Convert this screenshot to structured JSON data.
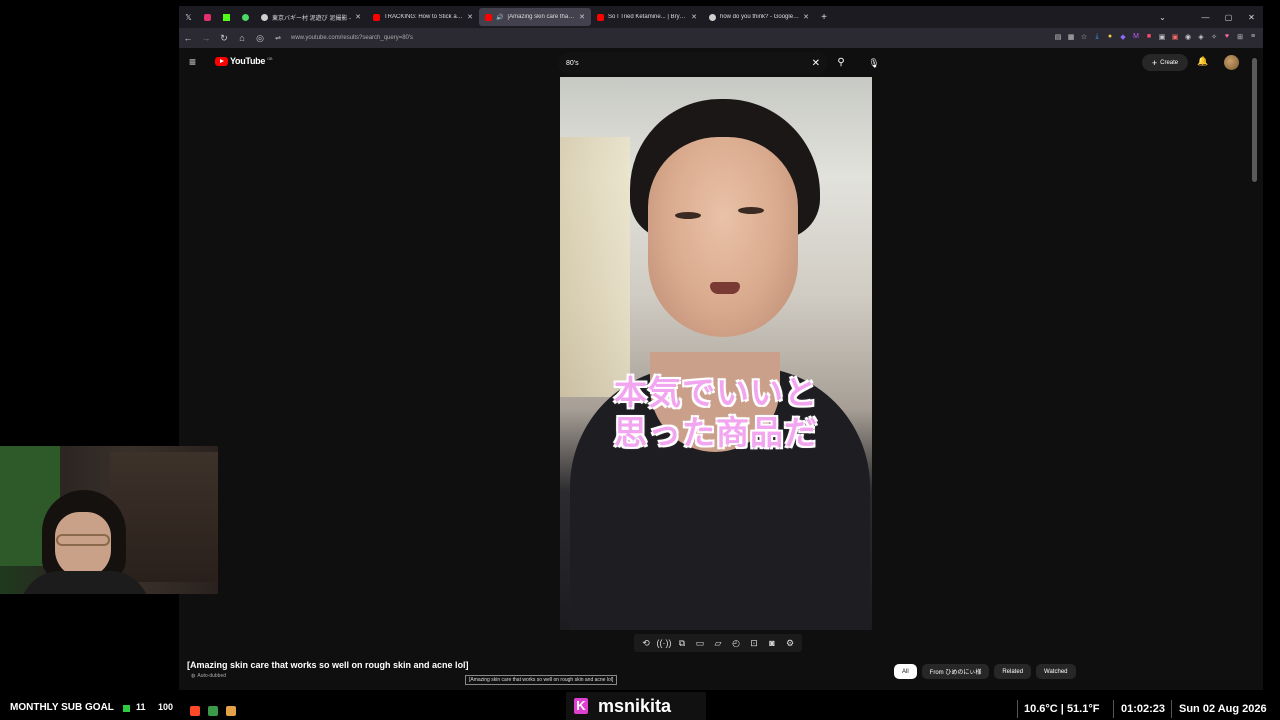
{
  "browser": {
    "pinned_tabs": [
      "x-icon",
      "instagram-icon",
      "kick-icon",
      "circle-icon"
    ],
    "tabs": [
      {
        "title": "東京バギー村 泥遊び 泥撮影 - ",
        "active": false,
        "favicon_color": "#cfcfcf"
      },
      {
        "title": "TRACKING: How to Stick an IMA",
        "active": false,
        "favicon_color": "#ff0000"
      },
      {
        "title": "[Amazing skin care that wo",
        "active": true,
        "favicon_color": "#ff0000"
      },
      {
        "title": "So I Tried Ketamine... | Bryan Jo",
        "active": false,
        "favicon_color": "#ff0000"
      },
      {
        "title": "how do you think? - Google Se",
        "active": false,
        "favicon_color": "#cfcfcf"
      }
    ],
    "new_tab": "+",
    "url": "www.youtube.com/results?search_query=80's"
  },
  "youtube": {
    "logo_text": "YouTube",
    "logo_country": "GB",
    "search_value": "80's",
    "create_label": "Create",
    "video_caption_line1": "本気でいいと",
    "video_caption_line2": "思った商品だ",
    "video_title": "[Amazing skin care that works so well on rough skin and acne lol]",
    "auto_dubbed": "Auto-dubbed",
    "tooltip": "[Amazing skin care that works so well on rough skin and acne lol]",
    "chips": [
      {
        "label": "All",
        "selected": true
      },
      {
        "label": "From ひめのにぃ様",
        "selected": false
      },
      {
        "label": "Related",
        "selected": false
      },
      {
        "label": "Watched",
        "selected": false
      }
    ]
  },
  "overlay": {
    "sub_goal_label": "MONTHLY SUB GOAL",
    "sub_count": "11",
    "sub_target": "100",
    "streamer_name": "msnikita",
    "weather": "10.6°C  |  51.1°F",
    "time": "01:02:23",
    "date": "Sun 02 Aug 2026"
  }
}
